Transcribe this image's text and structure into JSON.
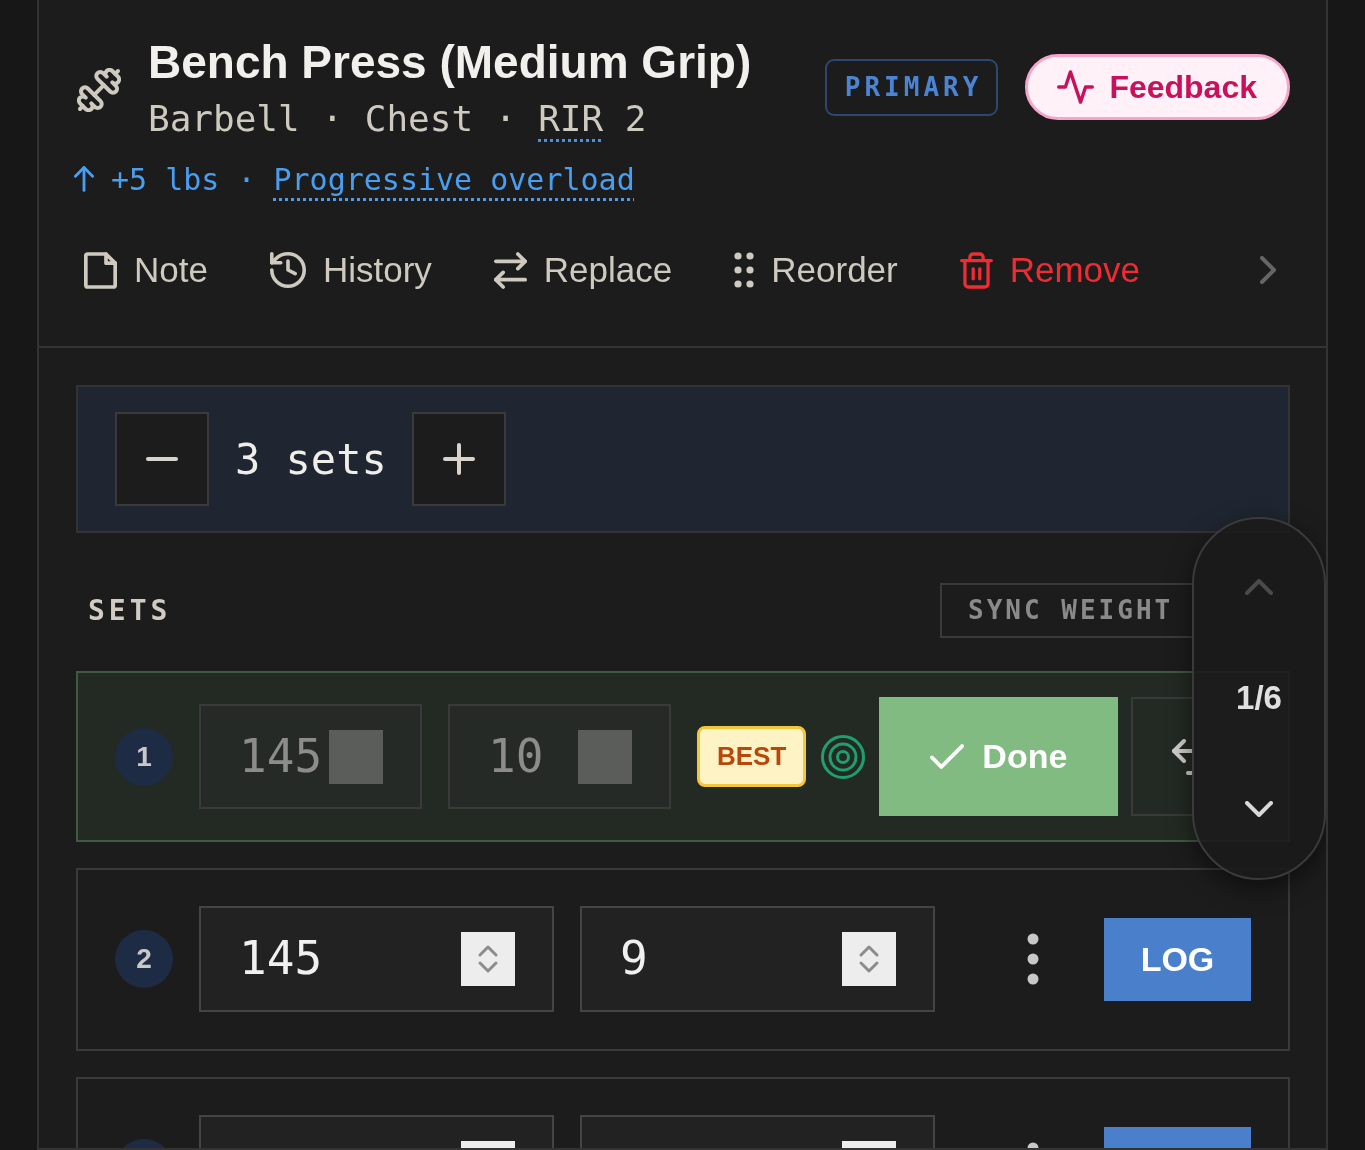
{
  "exercise": {
    "title": "Bench Press (Medium Grip)",
    "details": {
      "before": "Barbell · Chest ·",
      "term": "RIR",
      "after": "2"
    },
    "role_badge": "PRIMARY",
    "feedback_button": "Feedback",
    "progression": {
      "change": "+5 lbs ·",
      "link": "Progressive overload"
    }
  },
  "toolbar": [
    {
      "kind": "note",
      "label": "Note",
      "danger": false
    },
    {
      "kind": "history",
      "label": "History",
      "danger": false
    },
    {
      "kind": "replace",
      "label": "Replace",
      "danger": false
    },
    {
      "kind": "reorder",
      "label": "Reorder",
      "danger": false
    },
    {
      "kind": "remove",
      "label": "Remove",
      "danger": true
    }
  ],
  "set_stepper": {
    "label": "3 sets"
  },
  "sets_header": {
    "title": "SETS",
    "sync_button": "SYNC WEIGHT"
  },
  "sets": [
    {
      "completed": true,
      "number": "1",
      "weight": "145",
      "reps": "10",
      "badge": "BEST",
      "action": "Done"
    },
    {
      "completed": false,
      "number": "2",
      "weight": "145",
      "reps": "9",
      "action": "LOG"
    },
    {
      "completed": false
    }
  ],
  "set_navigator": {
    "position": "1/6",
    "prev_disabled": true,
    "next_disabled": false
  }
}
